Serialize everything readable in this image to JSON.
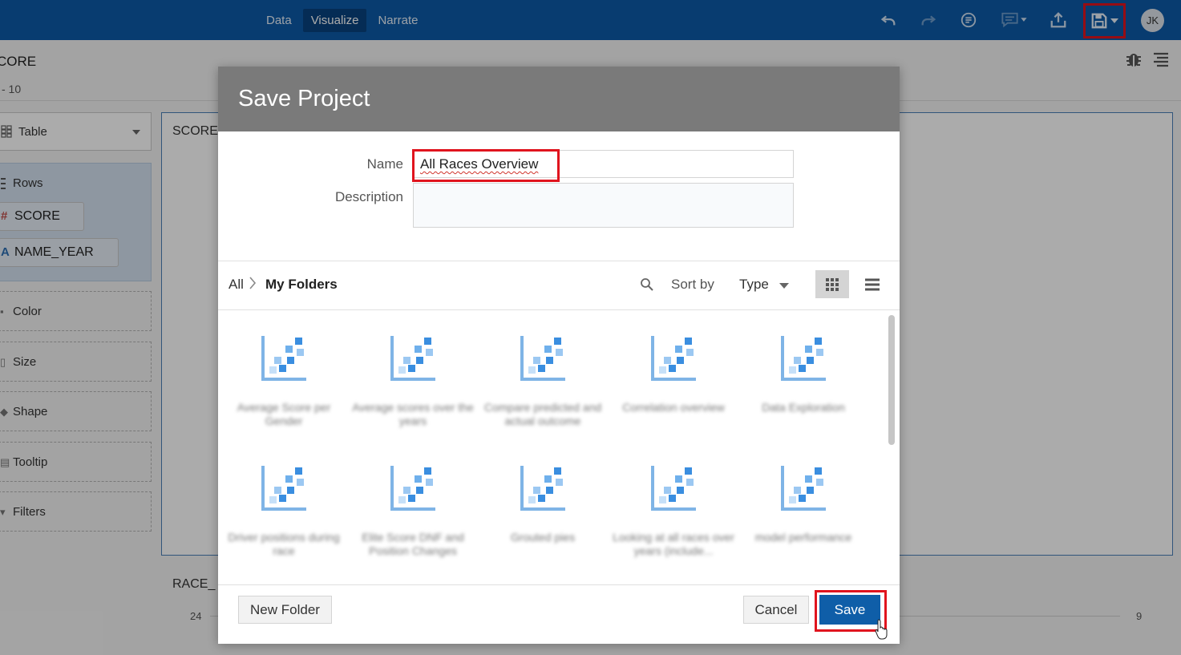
{
  "topbar": {
    "tabs": [
      {
        "label": "Data",
        "active": false
      },
      {
        "label": "Visualize",
        "active": true
      },
      {
        "label": "Narrate",
        "active": false
      }
    ],
    "icons": [
      "undo-icon",
      "redo-icon",
      "present-icon",
      "comment-icon",
      "share-icon",
      "save-icon"
    ],
    "avatar": "JK",
    "brand_color": "#0d5aa7"
  },
  "workspace": {
    "project_title": "CORE",
    "project_subtitle": "- 10",
    "vis_type": "Table",
    "rows_label": "Rows",
    "row_chips": [
      {
        "label": "SCORE",
        "symbol": "#"
      },
      {
        "label": "NAME_YEAR",
        "symbol": "A"
      }
    ],
    "drop_targets": [
      "Color",
      "Size",
      "Shape",
      "Tooltip",
      "Filters"
    ],
    "canvas_title": "SCORE",
    "second_canvas_title": "RACE_",
    "axis_left": "24",
    "axis_right": "9"
  },
  "dialog": {
    "title": "Save Project",
    "name_label": "Name",
    "name_value": "All Races Overview",
    "description_label": "Description",
    "description_value": "",
    "breadcrumb_root": "All",
    "breadcrumb_current": "My Folders",
    "sort_label": "Sort by",
    "sort_value": "Type",
    "items": [
      {
        "caption": "Average Score per Gender"
      },
      {
        "caption": "Average scores over the years"
      },
      {
        "caption": "Compare predicted and actual outcome"
      },
      {
        "caption": "Correlation overview"
      },
      {
        "caption": "Data Exploration"
      },
      {
        "caption": "Driver positions during race"
      },
      {
        "caption": "Elite Score DNF and Position Changes"
      },
      {
        "caption": "Grouted pies"
      },
      {
        "caption": "Looking at all races over years (include..."
      },
      {
        "caption": "model performance"
      }
    ],
    "new_folder_label": "New Folder",
    "cancel_label": "Cancel",
    "save_label": "Save",
    "primary_color": "#0f5ea8",
    "highlight_color": "#e0141e"
  }
}
